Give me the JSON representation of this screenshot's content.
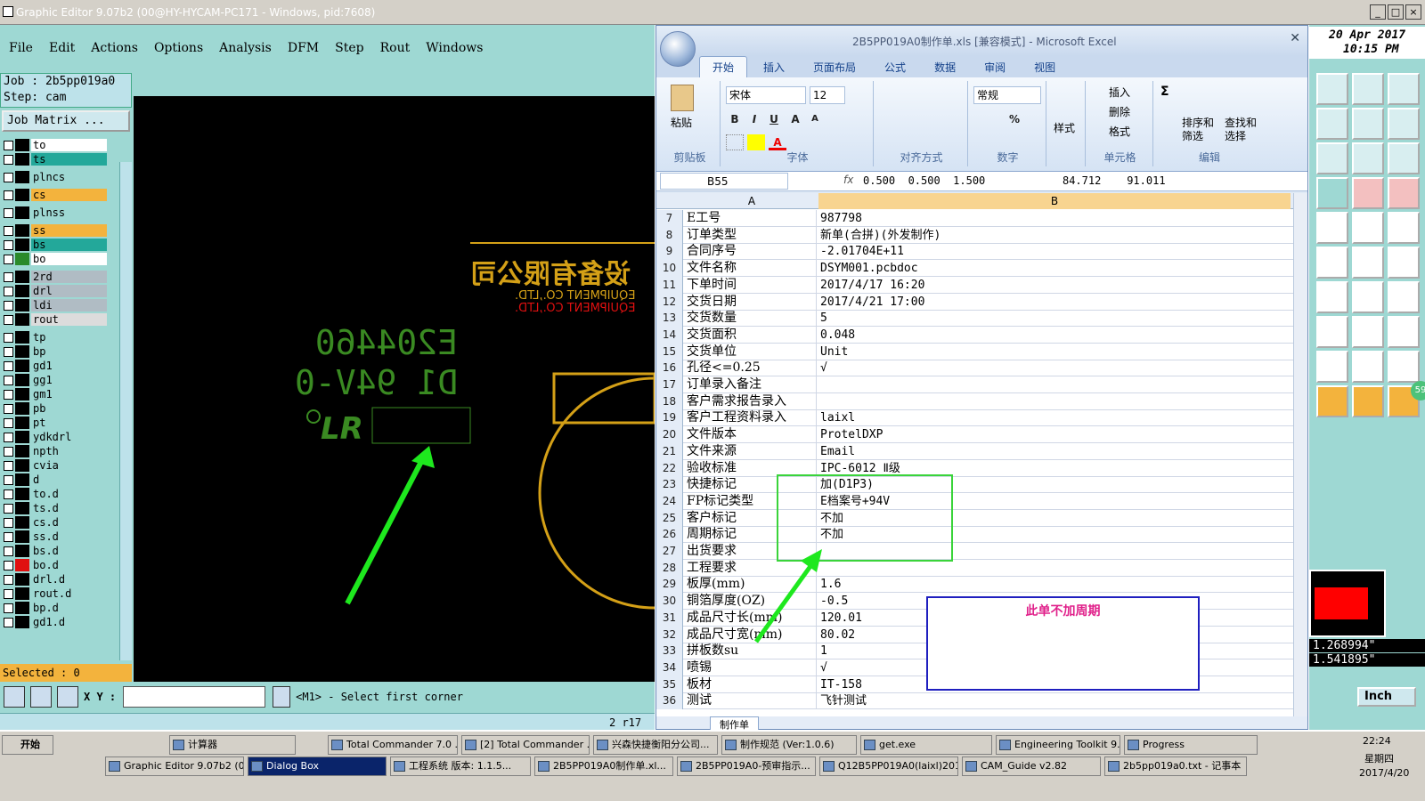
{
  "titlebar": {
    "title": "Graphic Editor 9.07b2 (00@HY-HYCAM-PC171 - Windows, pid:7608)"
  },
  "ge": {
    "menu": [
      "File",
      "Edit",
      "Actions",
      "Options",
      "Analysis",
      "DFM",
      "Step",
      "Rout",
      "Windows"
    ],
    "job": "Job : 2b5pp019a0",
    "step": "Step: cam",
    "matrix_button": "Job Matrix ...",
    "selected": "Selected : 0",
    "xy_label": "X Y :",
    "command_prompt": "<M1> - Select first corner",
    "status_text": "2 r17",
    "layers": [
      {
        "name": "to",
        "color": "#ffffff",
        "sw": "#000000"
      },
      {
        "name": "ts",
        "color": "#23a89a",
        "sw": "#000000"
      },
      {
        "name": "plncs",
        "color": "#9ed8d3",
        "sw": "#000000"
      },
      {
        "name": "cs",
        "color": "#f3b33d",
        "sw": "#000000"
      },
      {
        "name": "plnss",
        "color": "#9ed8d3",
        "sw": "#000000"
      },
      {
        "name": "ss",
        "color": "#f3b33d",
        "sw": "#000000"
      },
      {
        "name": "bs",
        "color": "#23a89a",
        "sw": "#000000"
      },
      {
        "name": "bo",
        "color": "#ffffff",
        "sw": "#2a8a2a"
      },
      {
        "name": "2rd",
        "color": "#b0bcc4",
        "sw": "#000000"
      },
      {
        "name": "drl",
        "color": "#b0bcc4",
        "sw": "#000000"
      },
      {
        "name": "ldi",
        "color": "#b0bcc4",
        "sw": "#000000"
      },
      {
        "name": "rout",
        "color": "#dcdcdc",
        "sw": "#000000"
      },
      {
        "name": "tp",
        "color": "#9ed8d3",
        "sw": "#000000"
      },
      {
        "name": "bp",
        "color": "#9ed8d3",
        "sw": "#000000"
      },
      {
        "name": "gd1",
        "color": "#9ed8d3",
        "sw": "#000000"
      },
      {
        "name": "gg1",
        "color": "#9ed8d3",
        "sw": "#000000"
      },
      {
        "name": "gm1",
        "color": "#9ed8d3",
        "sw": "#000000"
      },
      {
        "name": "pb",
        "color": "#9ed8d3",
        "sw": "#000000"
      },
      {
        "name": "pt",
        "color": "#9ed8d3",
        "sw": "#000000"
      },
      {
        "name": "ydkdrl",
        "color": "#9ed8d3",
        "sw": "#000000"
      },
      {
        "name": "npth",
        "color": "#9ed8d3",
        "sw": "#000000"
      },
      {
        "name": "cvia",
        "color": "#9ed8d3",
        "sw": "#000000"
      },
      {
        "name": "d",
        "color": "#9ed8d3",
        "sw": "#000000"
      },
      {
        "name": "to.d",
        "color": "#9ed8d3",
        "sw": "#000000"
      },
      {
        "name": "ts.d",
        "color": "#9ed8d3",
        "sw": "#000000"
      },
      {
        "name": "cs.d",
        "color": "#9ed8d3",
        "sw": "#000000"
      },
      {
        "name": "ss.d",
        "color": "#9ed8d3",
        "sw": "#000000"
      },
      {
        "name": "bs.d",
        "color": "#9ed8d3",
        "sw": "#000000"
      },
      {
        "name": "bo.d",
        "color": "#9ed8d3",
        "sw": "#e01010"
      },
      {
        "name": "drl.d",
        "color": "#9ed8d3",
        "sw": "#000000"
      },
      {
        "name": "rout.d",
        "color": "#9ed8d3",
        "sw": "#000000"
      },
      {
        "name": "bp.d",
        "color": "#9ed8d3",
        "sw": "#000000"
      },
      {
        "name": "gd1.d",
        "color": "#9ed8d3",
        "sw": "#000000"
      }
    ],
    "canvas": {
      "company_cn": "设备有限公司",
      "company_en": "EQUIPMENT CO.,LTD.",
      "ul_code": "E204460",
      "rating": "D1 94V-0",
      "ur_mark": "LR"
    }
  },
  "excel": {
    "title": "2B5PP019A0制作单.xls  [兼容模式] - Microsoft Excel",
    "tabs": [
      "开始",
      "插入",
      "页面布局",
      "公式",
      "数据",
      "审阅",
      "视图"
    ],
    "active_tab": "开始",
    "ribbon": {
      "paste": "粘贴",
      "clipboard": "剪贴板",
      "font_name": "宋体",
      "font_size": "12",
      "font_group": "字体",
      "align_group": "对齐方式",
      "number_format": "常规",
      "number_group": "数字",
      "style": "样式",
      "insert": "插入",
      "delete": "删除",
      "format": "格式",
      "cells_group": "单元格",
      "sort": "排序和筛选",
      "find": "查找和选择",
      "edit_group": "编辑"
    },
    "name_box": "B55",
    "formula": "0.500  0.500  1.500            84.712    91.011",
    "col_a": "A",
    "col_b": "B",
    "rows": [
      {
        "n": "7",
        "a": "E工号",
        "b": "987798"
      },
      {
        "n": "8",
        "a": "订单类型",
        "b": "新单(合拼)(外发制作)"
      },
      {
        "n": "9",
        "a": "合同序号",
        "b": "-2.01704E+11"
      },
      {
        "n": "10",
        "a": "文件名称",
        "b": "DSYM001.pcbdoc"
      },
      {
        "n": "11",
        "a": "下单时间",
        "b": "2017/4/17 16:20"
      },
      {
        "n": "12",
        "a": "交货日期",
        "b": "2017/4/21 17:00"
      },
      {
        "n": "13",
        "a": "交货数量",
        "b": "5"
      },
      {
        "n": "14",
        "a": "交货面积",
        "b": "0.048"
      },
      {
        "n": "15",
        "a": "交货单位",
        "b": "Unit"
      },
      {
        "n": "16",
        "a": "孔径<=0.25",
        "b": "√"
      },
      {
        "n": "17",
        "a": "订单录入备注",
        "b": ""
      },
      {
        "n": "18",
        "a": "客户需求报告录入",
        "b": ""
      },
      {
        "n": "19",
        "a": "客户工程资料录入",
        "b": "laixl"
      },
      {
        "n": "20",
        "a": "文件版本",
        "b": "ProtelDXP"
      },
      {
        "n": "21",
        "a": "文件来源",
        "b": "Email"
      },
      {
        "n": "22",
        "a": "验收标准",
        "b": "IPC-6012 Ⅱ级"
      },
      {
        "n": "23",
        "a": "快捷标记",
        "b": "加(D1P3)"
      },
      {
        "n": "24",
        "a": "FP标记类型",
        "b": "E档案号+94V"
      },
      {
        "n": "25",
        "a": "客户标记",
        "b": "不加"
      },
      {
        "n": "26",
        "a": "周期标记",
        "b": "不加"
      },
      {
        "n": "27",
        "a": "出货要求",
        "b": ""
      },
      {
        "n": "28",
        "a": "工程要求",
        "b": ""
      },
      {
        "n": "29",
        "a": "板厚(mm)",
        "b": "1.6"
      },
      {
        "n": "30",
        "a": "铜箔厚度(OZ)",
        "b": "-0.5"
      },
      {
        "n": "31",
        "a": "成品尺寸长(mm)",
        "b": "120.01"
      },
      {
        "n": "32",
        "a": "成品尺寸宽(mm)",
        "b": "80.02"
      },
      {
        "n": "33",
        "a": "拼板数su",
        "b": "1"
      },
      {
        "n": "34",
        "a": "喷锡",
        "b": "√"
      },
      {
        "n": "35",
        "a": "板材",
        "b": "IT-158"
      },
      {
        "n": "36",
        "a": "测试",
        "b": "飞针测试"
      }
    ],
    "sheet_tab": "制作单",
    "note": "此单不加周期"
  },
  "right_panel": {
    "date": "20 Apr 2017",
    "time": "10:15 PM",
    "coord1": "1.268994\"",
    "coord2": "1.541895\"",
    "unit_button": "Inch",
    "badge": "59"
  },
  "taskbar": {
    "start": "开始",
    "row1": [
      "计算器",
      "Total Commander 7.0 ...",
      "[2] Total Commander ...",
      "兴森快捷衡阳分公司...",
      "制作规范 (Ver:1.0.6)",
      "get.exe",
      "Engineering Toolkit 9....",
      "Progress"
    ],
    "row2": [
      "Graphic Editor 9.07b2 (0...",
      "Dialog Box",
      "工程系统  版本: 1.1.5...",
      "2B5PP019A0制作单.xl...",
      "2B5PP019A0-预审指示...",
      "Q12B5PP019A0(laixl)201...",
      "CAM_Guide v2.82",
      "2b5pp019a0.txt - 记事本"
    ],
    "clock": "22:24",
    "weekday": "星期四",
    "date": "2017/4/20"
  },
  "colors": {
    "arrow": "#1ee81e",
    "note_border": "#1f1fbf",
    "note_text": "#e0208a",
    "silk": "#d4a017",
    "green_text": "#3a8a22"
  }
}
